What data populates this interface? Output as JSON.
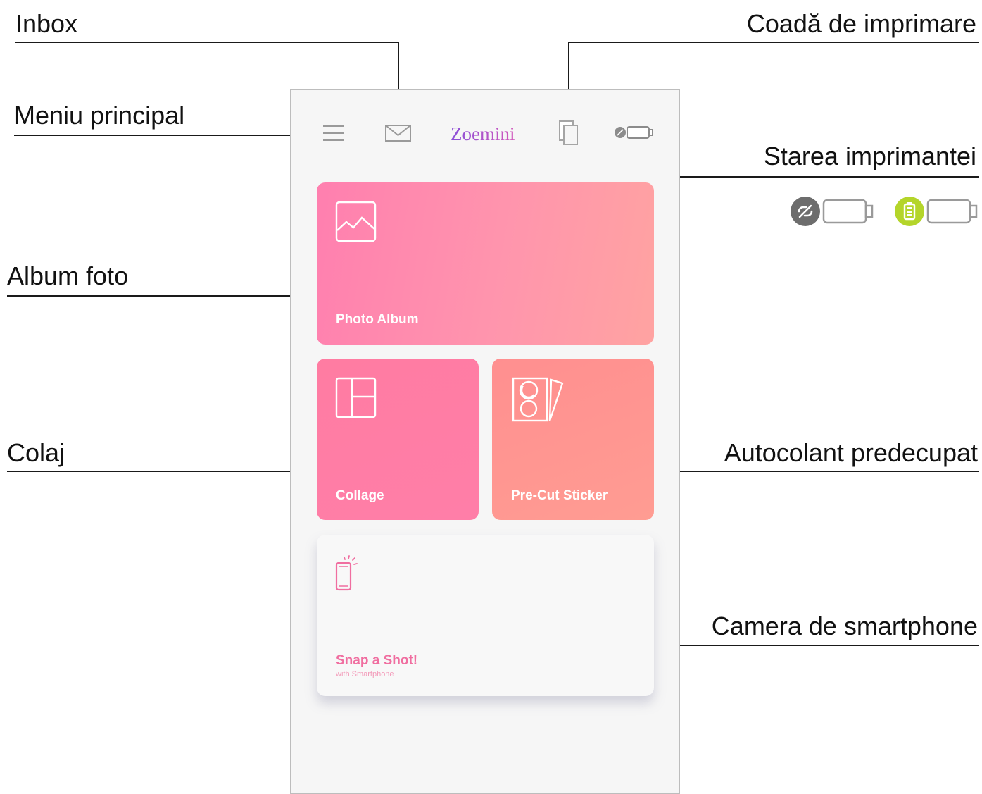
{
  "callouts": {
    "inbox": "Inbox",
    "print_queue": "Coadă de imprimare",
    "main_menu": "Meniu principal",
    "printer_status": "Starea imprimantei",
    "photo_album": "Album foto",
    "collage": "Colaj",
    "precut_sticker": "Autocolant predecupat",
    "smartphone_camera": "Camera de smartphone"
  },
  "app": {
    "title": "Zoemini",
    "icons": [
      "menu-icon",
      "mail-icon",
      "print-queue-icon",
      "printer-status-icon"
    ]
  },
  "tiles": {
    "photo_album": {
      "label": "Photo Album",
      "icon": "image-icon"
    },
    "collage": {
      "label": "Collage",
      "icon": "collage-icon"
    },
    "sticker": {
      "label": "Pre-Cut Sticker",
      "icon": "sticker-icon"
    },
    "snap": {
      "label": "Snap a Shot!",
      "sublabel": "with Smartphone",
      "icon": "smartphone-icon"
    }
  },
  "status_legend": {
    "disconnected_icon": "link-off-icon",
    "battery_icon": "battery-icon"
  },
  "colors": {
    "photo_tile": "#ff8fae",
    "collage_tile": "#ff7ca5",
    "sticker_tile": "#ff9690",
    "snap_label": "#f06ea0",
    "battery_badge": "#b4d52a",
    "disconnected_badge": "#6d6d6d"
  }
}
